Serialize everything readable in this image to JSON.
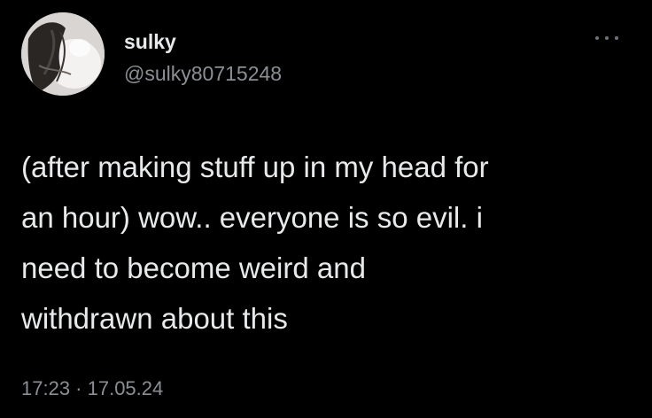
{
  "author": {
    "display_name": "sulky",
    "handle": "@sulky80715248",
    "avatar_icon": "profile-photo"
  },
  "more_icon": "more-dots-icon",
  "tweet": {
    "lines": [
      "(after making stuff up in my head for",
      "an hour) wow.. everyone is so evil. i",
      "need to become weird and",
      "withdrawn about this"
    ]
  },
  "meta": {
    "timestamp": "17:23 · 17.05.24"
  },
  "colors": {
    "background": "#000000",
    "text_primary": "#e7e9ea",
    "text_secondary": "#8b8f94"
  }
}
